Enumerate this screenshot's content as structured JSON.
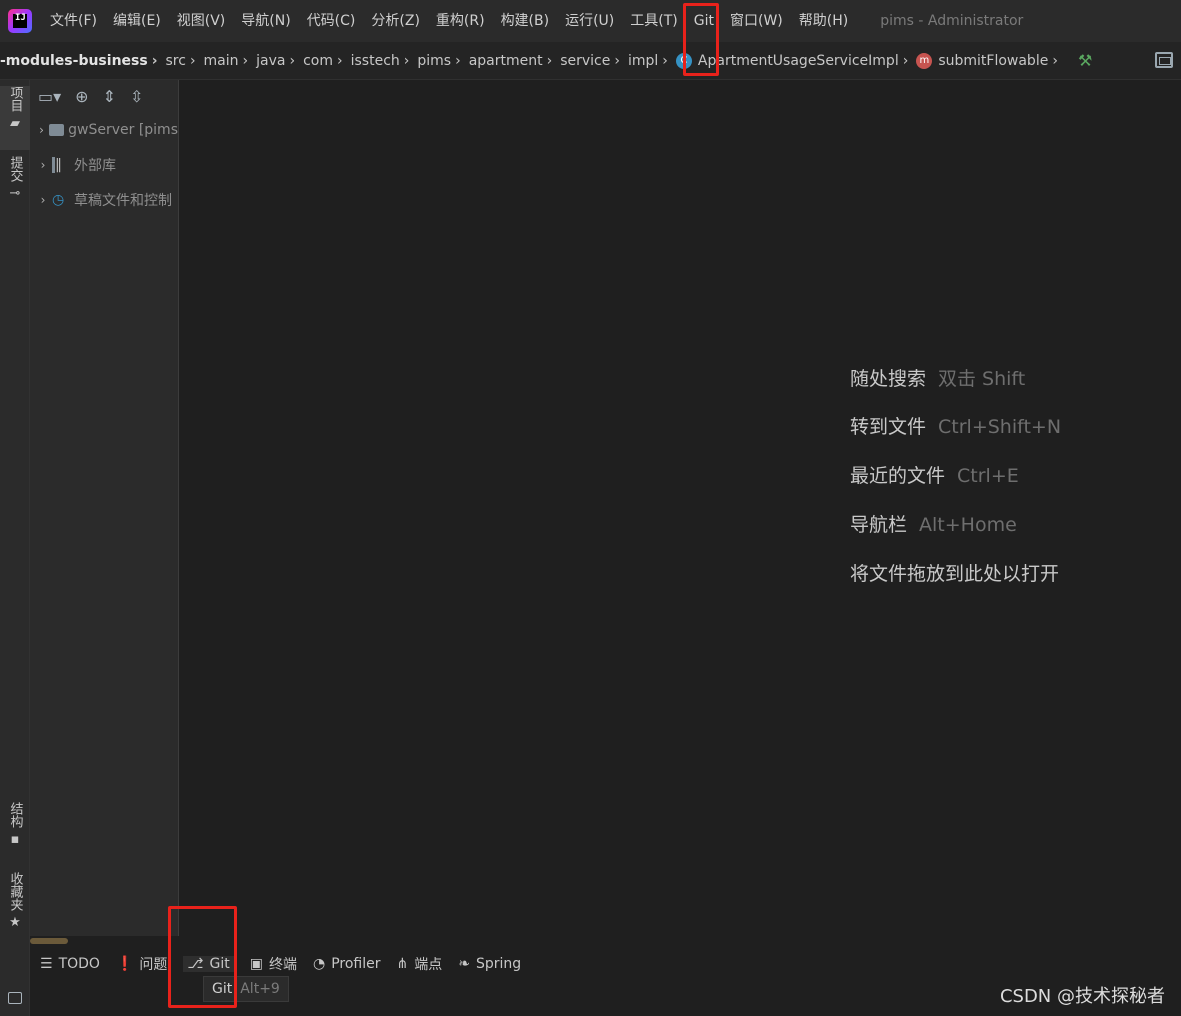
{
  "menubar": {
    "items": [
      "文件(F)",
      "编辑(E)",
      "视图(V)",
      "导航(N)",
      "代码(C)",
      "分析(Z)",
      "重构(R)",
      "构建(B)",
      "运行(U)",
      "工具(T)",
      "Git",
      "窗口(W)",
      "帮助(H)"
    ],
    "window_title": "pims - Administrator"
  },
  "breadcrumb": {
    "items": [
      "-modules-business",
      "src",
      "main",
      "java",
      "com",
      "isstech",
      "pims",
      "apartment",
      "service",
      "impl",
      "ApartmentUsageServiceImpl",
      "submitFlowable"
    ],
    "class_icon": "C",
    "method_icon": "m"
  },
  "left_strip": {
    "project": "项目",
    "commit": "提交",
    "structure": "结构",
    "favorites": "收藏夹"
  },
  "project_tree": {
    "rows": [
      {
        "label": "gwServer [pims"
      },
      {
        "label": "外部库"
      },
      {
        "label": "草稿文件和控制"
      }
    ]
  },
  "editor_hints": [
    {
      "action": "随处搜索",
      "shortcut": "双击 Shift"
    },
    {
      "action": "转到文件",
      "shortcut": "Ctrl+Shift+N"
    },
    {
      "action": "最近的文件",
      "shortcut": "Ctrl+E"
    },
    {
      "action": "导航栏",
      "shortcut": "Alt+Home"
    },
    {
      "action": "将文件拖放到此处以打开",
      "shortcut": ""
    }
  ],
  "bottom_bar": {
    "items": [
      "TODO",
      "问题",
      "Git",
      "终端",
      "Profiler",
      "端点",
      "Spring"
    ],
    "tooltip_title": "Git",
    "tooltip_key": "Alt+9"
  },
  "watermark": "CSDN @技术探秘者",
  "colors": {
    "highlight": "#e8221b",
    "background": "#1f1f1f",
    "panel": "#2b2b2b"
  }
}
